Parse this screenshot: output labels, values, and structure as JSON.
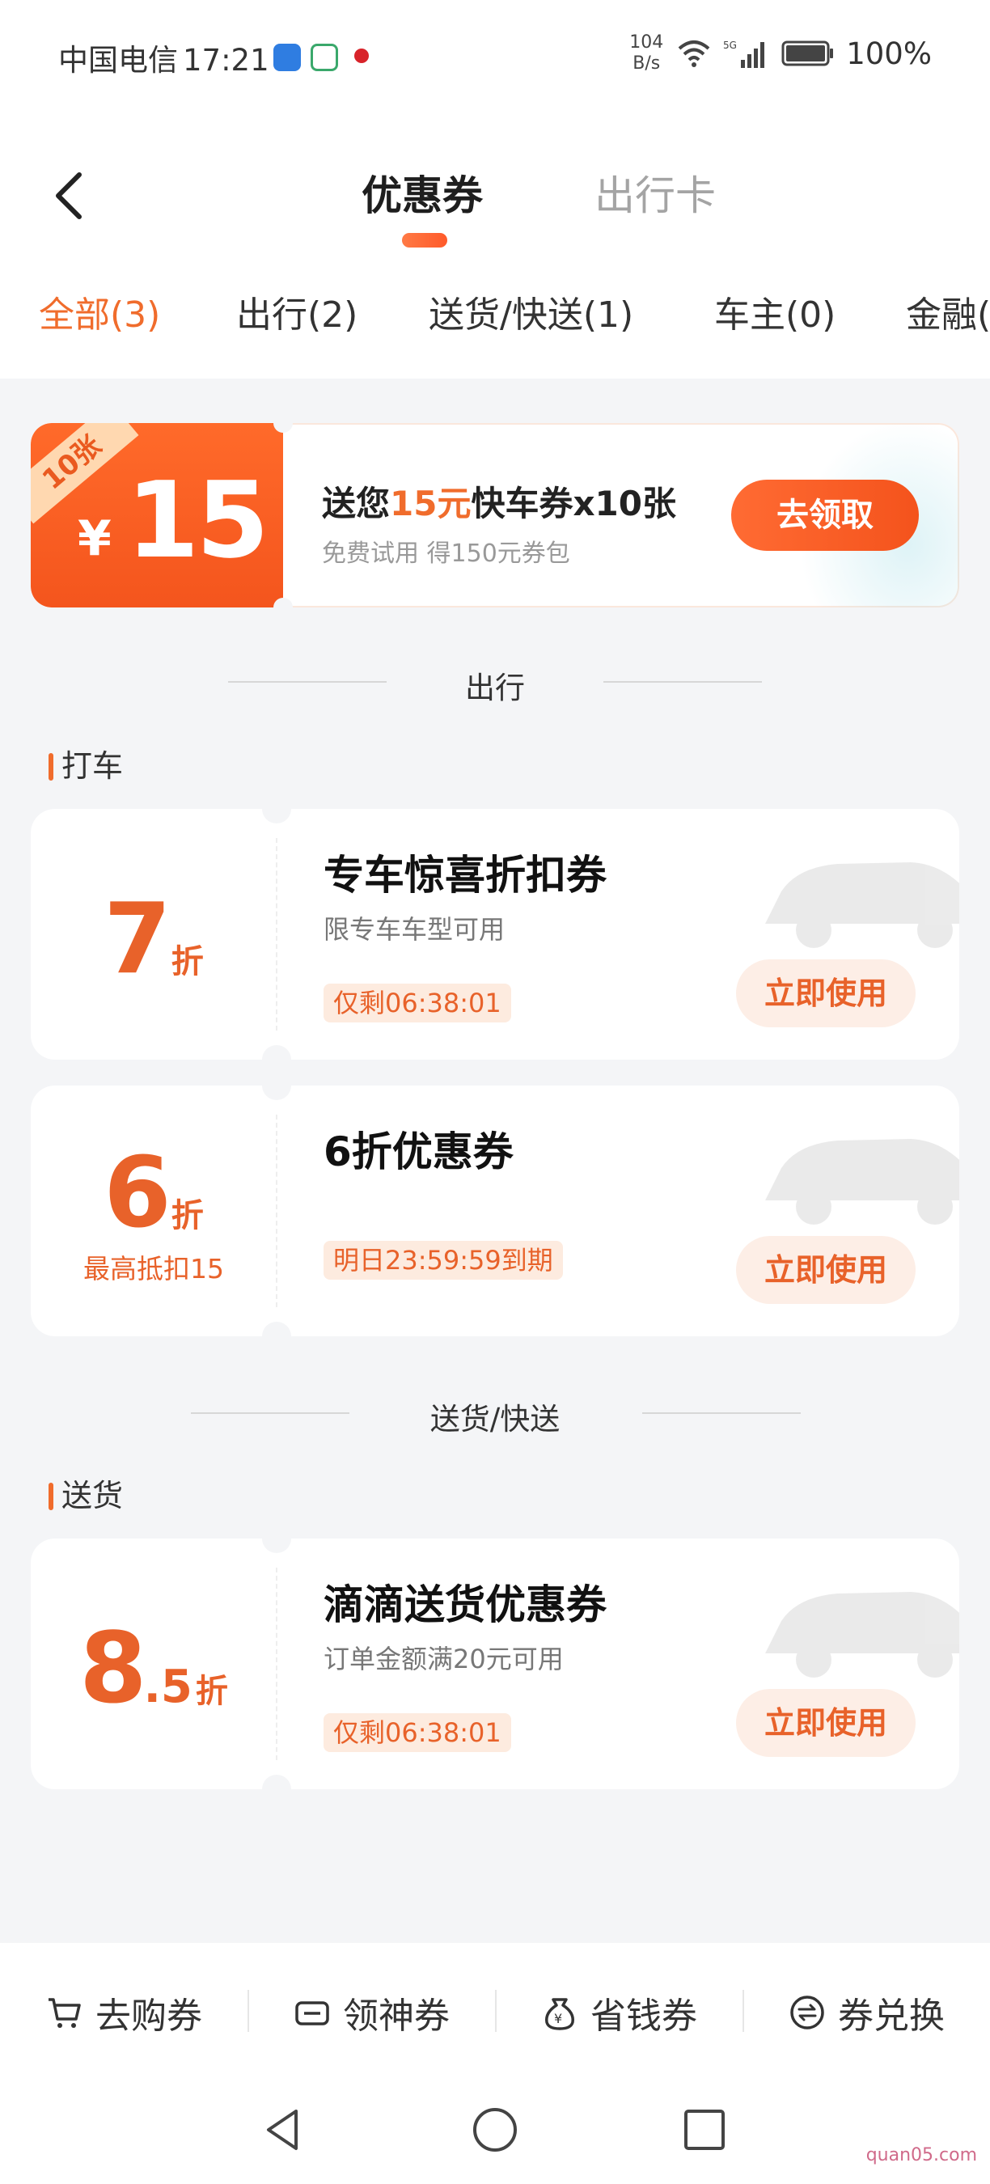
{
  "status_bar": {
    "carrier": "中国电信",
    "time": "17:21",
    "net_speed_value": "104",
    "net_speed_unit": "B/s",
    "battery": "100%"
  },
  "header": {
    "tabs": [
      {
        "label": "优惠券",
        "active": true
      },
      {
        "label": "出行卡",
        "active": false
      }
    ]
  },
  "categories": [
    {
      "label": "全部(3)",
      "active": true
    },
    {
      "label": "出行(2)",
      "active": false
    },
    {
      "label": "送货/快送(1)",
      "active": false
    },
    {
      "label": "车主(0)",
      "active": false
    },
    {
      "label": "金融(",
      "active": false
    }
  ],
  "promo": {
    "ribbon": "10张",
    "currency": "¥",
    "value": "15",
    "title_prefix": "送您",
    "title_highlight": "15元",
    "title_suffix": "快车券x10张",
    "subtitle": "免费试用 得150元券包",
    "button": "去领取"
  },
  "sections": [
    {
      "divider": "出行",
      "subheader": "打车",
      "coupons": [
        {
          "discount": "7",
          "unit": "折",
          "cap": "",
          "title": "专车惊喜折扣券",
          "desc": "限专车车型可用",
          "tag": "仅剩06:38:01",
          "button": "立即使用"
        },
        {
          "discount": "6",
          "unit": "折",
          "cap": "最高抵扣15",
          "title": "6折优惠券",
          "desc": "",
          "tag": "明日23:59:59到期",
          "button": "立即使用"
        }
      ]
    },
    {
      "divider": "送货/快送",
      "subheader": "送货",
      "coupons": [
        {
          "discount": "8",
          "discount_decimal": ".5",
          "unit": "折",
          "cap": "",
          "title": "滴滴送货优惠券",
          "desc": "订单金额满20元可用",
          "tag": "仅剩06:38:01",
          "button": "立即使用"
        }
      ]
    }
  ],
  "bottom_bar": [
    {
      "label": "去购券",
      "icon": "cart-icon"
    },
    {
      "label": "领神券",
      "icon": "ticket-icon"
    },
    {
      "label": "省钱券",
      "icon": "money-bag-icon"
    },
    {
      "label": "券兑换",
      "icon": "exchange-icon"
    }
  ],
  "nav_bar": [
    "back-nav-icon",
    "home-nav-icon",
    "recents-nav-icon"
  ],
  "watermark": "quan05.com",
  "colors": {
    "accent": "#f06c2c",
    "promo_orange": "#f4551d",
    "tag_bg": "#fdebdf",
    "page_bg": "#f4f5f7"
  }
}
